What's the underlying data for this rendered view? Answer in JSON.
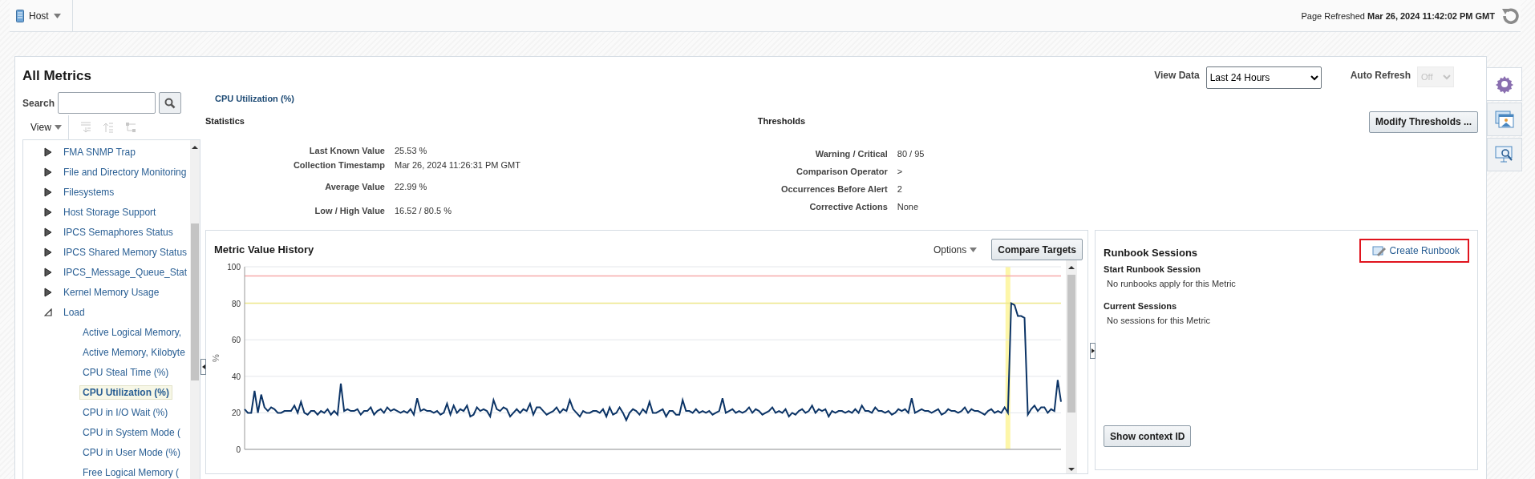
{
  "header": {
    "target_menu": "Host",
    "refreshed": "Page Refreshed **Mar 26, 2024 11:42:02 PM GMT**"
  },
  "sidebar": {
    "title": "All Metrics",
    "search": {
      "label": "Search"
    },
    "view_menu": "View",
    "tree": [
      {
        "label": "FMA SNMP Trap",
        "expanded": false,
        "selected": false
      },
      {
        "label": "File and Directory Monitoring",
        "expanded": false,
        "selected": false
      },
      {
        "label": "Filesystems",
        "expanded": false,
        "selected": false
      },
      {
        "label": "Host Storage Support",
        "expanded": false,
        "selected": false
      },
      {
        "label": "IPCS Semaphores Status",
        "expanded": false,
        "selected": false
      },
      {
        "label": "IPCS Shared Memory Status",
        "expanded": false,
        "selected": false
      },
      {
        "label": "IPCS_Message_Queue_Stat",
        "expanded": false,
        "selected": false
      },
      {
        "label": "Kernel Memory Usage",
        "expanded": false,
        "selected": false
      },
      {
        "label": "Load",
        "expanded": true,
        "selected": false,
        "children": [
          {
            "label": "Active Logical Memory,",
            "selected": false
          },
          {
            "label": "Active Memory, Kilobyte",
            "selected": false
          },
          {
            "label": "CPU Steal Time (%)",
            "selected": false
          },
          {
            "label": "CPU Utilization (%)",
            "selected": true
          },
          {
            "label": "CPU in I/O Wait (%)",
            "selected": false
          },
          {
            "label": "CPU in System Mode (",
            "selected": false
          },
          {
            "label": "CPU in User Mode (%)",
            "selected": false
          },
          {
            "label": "Free Logical Memory (",
            "selected": false
          }
        ]
      }
    ]
  },
  "metric_title": "CPU Utilization (%)",
  "view_data": {
    "label": "View Data",
    "value": "Last 24 Hours"
  },
  "auto_refresh": {
    "label": "Auto Refresh",
    "value": "Off",
    "disabled": true
  },
  "statistics": {
    "title": "Statistics",
    "rows": [
      {
        "label": "Last Known Value",
        "value": "25.53 %"
      },
      {
        "label": "Collection Timestamp",
        "value": "Mar 26, 2024 11:26:31 PM GMT"
      },
      {
        "label": "Average Value",
        "value": "22.99 %"
      },
      {
        "label": "Low / High Value",
        "value": "16.52 / 80.5 %"
      }
    ]
  },
  "thresholds": {
    "title": "Thresholds",
    "button": "Modify Thresholds ...",
    "rows": [
      {
        "label": "Warning / Critical",
        "value": "80 / 95"
      },
      {
        "label": "Comparison Operator",
        "value": ">"
      },
      {
        "label": "Occurrences Before Alert",
        "value": "2"
      },
      {
        "label": "Corrective Actions",
        "value": "None"
      }
    ]
  },
  "history": {
    "title": "Metric Value History",
    "options": "Options",
    "button": "Compare Targets",
    "chart_data": {
      "type": "line",
      "ylabel": "%",
      "ylim": [
        0,
        100
      ],
      "yticks": [
        0,
        20,
        40,
        60,
        80,
        100
      ],
      "grid": true,
      "series": [
        {
          "color": "#0c3466",
          "values": [
            22,
            20,
            20,
            32,
            20,
            30,
            23,
            21,
            23,
            22,
            20,
            20,
            21,
            21,
            21,
            24,
            20,
            26,
            20,
            19,
            21,
            21,
            19,
            21,
            20,
            22,
            19,
            21,
            19,
            36,
            21,
            22,
            21,
            21,
            22,
            19,
            21,
            21,
            23,
            19,
            21,
            22,
            20,
            23,
            21,
            22,
            21,
            20,
            21,
            20,
            22,
            19,
            28,
            21,
            22,
            21,
            21,
            20,
            21,
            19,
            20,
            25,
            19,
            24,
            20,
            22,
            21,
            24,
            18,
            19,
            23,
            21,
            22,
            21,
            18,
            27,
            22,
            21,
            23,
            22,
            18,
            20,
            22,
            20,
            22,
            21,
            25,
            19,
            23,
            23,
            21,
            19,
            20,
            21,
            23,
            20,
            22,
            21,
            27,
            22,
            20,
            18,
            21,
            20,
            20,
            21,
            21,
            20,
            22,
            18,
            23,
            19,
            20,
            23,
            20,
            16,
            20,
            22,
            21,
            19,
            22,
            20,
            26,
            20,
            20,
            21,
            22,
            18,
            21,
            21,
            19,
            19,
            27,
            21,
            21,
            20,
            22,
            20,
            21,
            20,
            21,
            19,
            20,
            21,
            28,
            20,
            21,
            22,
            20,
            21,
            20,
            21,
            23,
            20,
            22,
            21,
            19,
            20,
            21,
            23,
            20,
            21,
            20,
            22,
            18,
            20,
            19,
            21,
            22,
            20,
            21,
            24,
            20,
            22,
            21,
            22,
            18,
            21,
            20,
            21,
            21,
            20,
            21,
            20,
            22,
            20,
            24,
            21,
            21,
            20,
            23,
            21,
            21,
            20,
            21,
            19,
            20,
            22,
            21,
            22,
            20,
            28,
            20,
            21,
            22,
            21,
            21,
            20,
            21,
            22,
            19,
            20,
            22,
            21,
            21,
            20,
            21,
            23,
            20,
            22,
            21,
            21,
            20,
            19,
            21,
            22,
            20,
            21,
            20,
            23,
            20,
            80,
            79,
            73,
            73,
            72,
            19,
            22,
            24,
            21,
            23,
            23,
            20,
            22,
            21,
            38,
            26
          ]
        },
        {
          "color": "#f6aaaa",
          "values": [
            95,
            95,
            95,
            95,
            95,
            95,
            95,
            95,
            95,
            95,
            95,
            95,
            95,
            95,
            95,
            95,
            95,
            95,
            95,
            95,
            95,
            95,
            95,
            95,
            95,
            95,
            95,
            95,
            95,
            95,
            95,
            95,
            95,
            95,
            95,
            95,
            95,
            95,
            95,
            95,
            95,
            95,
            95,
            95,
            95,
            95,
            95,
            95,
            95,
            95,
            95,
            95,
            95,
            95,
            95,
            95,
            95,
            95,
            95,
            95,
            95,
            95,
            95,
            95,
            95,
            95,
            95,
            95,
            95,
            95,
            95,
            95,
            95,
            95,
            95,
            95,
            95,
            95,
            95,
            95,
            95,
            95,
            95,
            95,
            95,
            95,
            95,
            95,
            95,
            95,
            95,
            95,
            95,
            95,
            95,
            95,
            95,
            95,
            95,
            95,
            95,
            95,
            95,
            95,
            95,
            95,
            95,
            95,
            95,
            95,
            95,
            95,
            95,
            95,
            95,
            95,
            95,
            95,
            95,
            95,
            95,
            95,
            95,
            95,
            95,
            95,
            95,
            95,
            95,
            95,
            95,
            95,
            95,
            95,
            95,
            95,
            95,
            95,
            95,
            95,
            95,
            95,
            95,
            95,
            95,
            95,
            95,
            95,
            95,
            95,
            95,
            95,
            95,
            95,
            95,
            95,
            95,
            95,
            95,
            95,
            95,
            95,
            95,
            95,
            95,
            95,
            95,
            95,
            95,
            95,
            95,
            95,
            95,
            95,
            95,
            95,
            95,
            95,
            95,
            95,
            95,
            95,
            95,
            95,
            95,
            95,
            95,
            95,
            95,
            95,
            95,
            95,
            95,
            95,
            95,
            95,
            95,
            95,
            95,
            95,
            95,
            95,
            95,
            95,
            95,
            95,
            95,
            95,
            95,
            95,
            95,
            95,
            95,
            95,
            95,
            95,
            95,
            95,
            95,
            95,
            95,
            95,
            95,
            95,
            95,
            95,
            95,
            95,
            95,
            95,
            95,
            95,
            95,
            95,
            95,
            95,
            95,
            95,
            95,
            95,
            95,
            95,
            95,
            95,
            95,
            95,
            95
          ]
        },
        {
          "color": "#eee88a",
          "values": [
            80,
            80,
            80,
            80,
            80,
            80,
            80,
            80,
            80,
            80,
            80,
            80,
            80,
            80,
            80,
            80,
            80,
            80,
            80,
            80,
            80,
            80,
            80,
            80,
            80,
            80,
            80,
            80,
            80,
            80,
            80,
            80,
            80,
            80,
            80,
            80,
            80,
            80,
            80,
            80,
            80,
            80,
            80,
            80,
            80,
            80,
            80,
            80,
            80,
            80,
            80,
            80,
            80,
            80,
            80,
            80,
            80,
            80,
            80,
            80,
            80,
            80,
            80,
            80,
            80,
            80,
            80,
            80,
            80,
            80,
            80,
            80,
            80,
            80,
            80,
            80,
            80,
            80,
            80,
            80,
            80,
            80,
            80,
            80,
            80,
            80,
            80,
            80,
            80,
            80,
            80,
            80,
            80,
            80,
            80,
            80,
            80,
            80,
            80,
            80,
            80,
            80,
            80,
            80,
            80,
            80,
            80,
            80,
            80,
            80,
            80,
            80,
            80,
            80,
            80,
            80,
            80,
            80,
            80,
            80,
            80,
            80,
            80,
            80,
            80,
            80,
            80,
            80,
            80,
            80,
            80,
            80,
            80,
            80,
            80,
            80,
            80,
            80,
            80,
            80,
            80,
            80,
            80,
            80,
            80,
            80,
            80,
            80,
            80,
            80,
            80,
            80,
            80,
            80,
            80,
            80,
            80,
            80,
            80,
            80,
            80,
            80,
            80,
            80,
            80,
            80,
            80,
            80,
            80,
            80,
            80,
            80,
            80,
            80,
            80,
            80,
            80,
            80,
            80,
            80,
            80,
            80,
            80,
            80,
            80,
            80,
            80,
            80,
            80,
            80,
            80,
            80,
            80,
            80,
            80,
            80,
            80,
            80,
            80,
            80,
            80,
            80,
            80,
            80,
            80,
            80,
            80,
            80,
            80,
            80,
            80,
            80,
            80,
            80,
            80,
            80,
            80,
            80,
            80,
            80,
            80,
            80,
            80,
            80,
            80,
            80,
            80,
            80,
            80,
            80,
            80,
            80,
            80,
            80,
            80,
            80,
            80,
            80,
            80,
            80,
            80,
            80,
            80,
            80,
            80,
            80,
            80
          ]
        }
      ]
    }
  },
  "runbook": {
    "title": "Runbook Sessions",
    "create_link": "Create Runbook",
    "sections": [
      {
        "title": "Start Runbook Session",
        "text": "No runbooks apply for this Metric"
      },
      {
        "title": "Current Sessions",
        "text": "No sessions for this Metric"
      }
    ],
    "button": "Show context ID"
  },
  "side_tabs": [
    {
      "kind": "settings",
      "selected": true
    },
    {
      "kind": "gallery",
      "selected": false
    },
    {
      "kind": "monitor-search",
      "selected": false
    }
  ]
}
